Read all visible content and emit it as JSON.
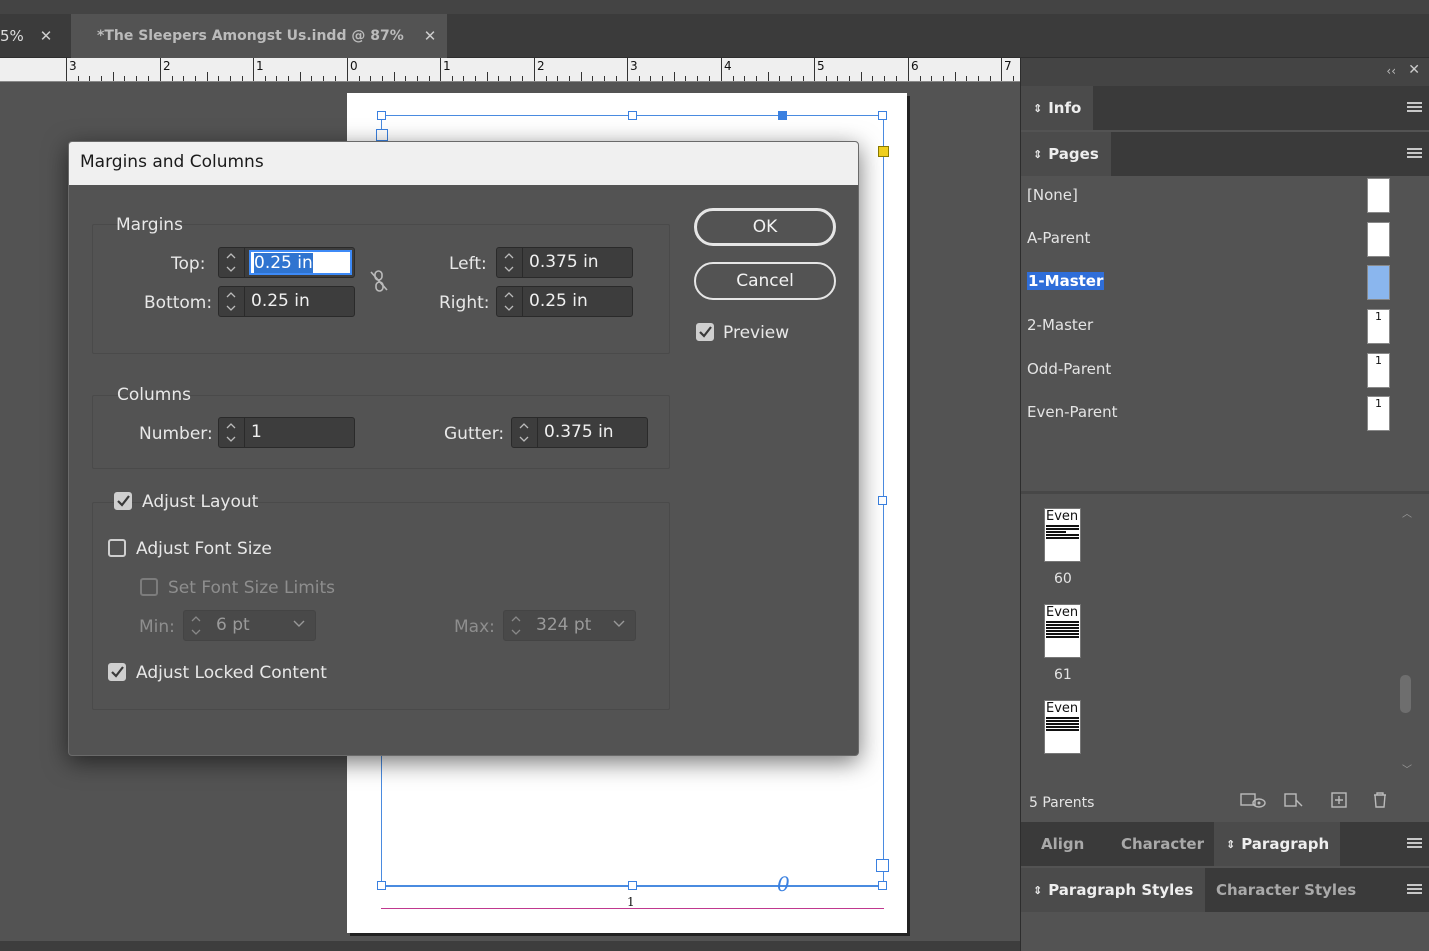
{
  "tabs": [
    {
      "label": "5%",
      "close": "✕"
    },
    {
      "label": "*The Sleepers Amongst Us.indd @ 87%",
      "close": "✕"
    }
  ],
  "ruler": {
    "numbers": [
      "3",
      "2",
      "1",
      "0",
      "1",
      "2",
      "3",
      "4",
      "5",
      "6",
      "7"
    ]
  },
  "page": {
    "folio": "1",
    "page_marker": "0"
  },
  "dialog": {
    "title": "Margins and Columns",
    "margins": {
      "heading": "Margins",
      "top_label": "Top:",
      "top_value": "0.25 in",
      "bottom_label": "Bottom:",
      "bottom_value": "0.25 in",
      "left_label": "Left:",
      "left_value": "0.375 in",
      "right_label": "Right:",
      "right_value": "0.25 in"
    },
    "columns": {
      "heading": "Columns",
      "number_label": "Number:",
      "number_value": "1",
      "gutter_label": "Gutter:",
      "gutter_value": "0.375 in"
    },
    "adjust": {
      "adjust_layout": "Adjust Layout",
      "adjust_layout_checked": true,
      "adjust_font_size": "Adjust Font Size",
      "adjust_font_size_checked": false,
      "set_font_size_limits": "Set Font Size Limits",
      "set_font_size_limits_checked": false,
      "min_label": "Min:",
      "min_value": "6 pt",
      "max_label": "Max:",
      "max_value": "324 pt",
      "adjust_locked": "Adjust Locked Content",
      "adjust_locked_checked": true
    },
    "ok_label": "OK",
    "cancel_label": "Cancel",
    "preview_label": "Preview",
    "preview_checked": true
  },
  "panel": {
    "info_tab": "Info",
    "pages_tab": "Pages",
    "parents": [
      {
        "name": "[None]",
        "thumb": ""
      },
      {
        "name": "A-Parent",
        "thumb": ""
      },
      {
        "name": "1-Master",
        "thumb": "",
        "selected": true
      },
      {
        "name": "2-Master",
        "thumb": "1"
      },
      {
        "name": "Odd-Parent",
        "thumb": "1"
      },
      {
        "name": "Even-Parent",
        "thumb": "1"
      }
    ],
    "pages": [
      {
        "label": "Even",
        "number": "60"
      },
      {
        "label": "Even",
        "number": "61"
      },
      {
        "label": "Even",
        "number": ""
      }
    ],
    "footer_text": "5 Parents",
    "align_tab": "Align",
    "character_tab": "Character",
    "paragraph_tab": "Paragraph",
    "paragraph_styles_tab": "Paragraph Styles",
    "character_styles_tab": "Character Styles"
  },
  "colors": {
    "accent": "#2f74d0",
    "selection": "#8ab6ee",
    "frame": "#4a8be0"
  }
}
